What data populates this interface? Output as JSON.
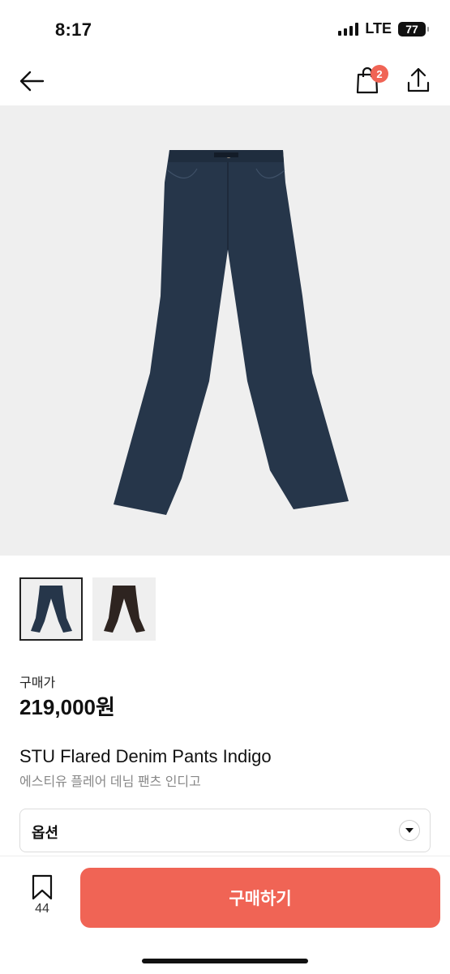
{
  "status_bar": {
    "time": "8:17",
    "network": "LTE",
    "battery": "77"
  },
  "header": {
    "cart_count": "2"
  },
  "product": {
    "price_label": "구매가",
    "price": "219,000원",
    "name_en": "STU Flared Denim Pants Indigo",
    "name_ko": "에스티유 플레어 데님 팬츠 인디고",
    "selected_variant": "Indigo",
    "variants": [
      "Indigo",
      "Brown"
    ],
    "colors": {
      "indigo": "#26364a",
      "brown": "#2e2420"
    }
  },
  "option": {
    "label": "옵션"
  },
  "bottom": {
    "bookmark_count": "44",
    "buy_label": "구매하기"
  },
  "theme": {
    "accent": "#f06455"
  }
}
